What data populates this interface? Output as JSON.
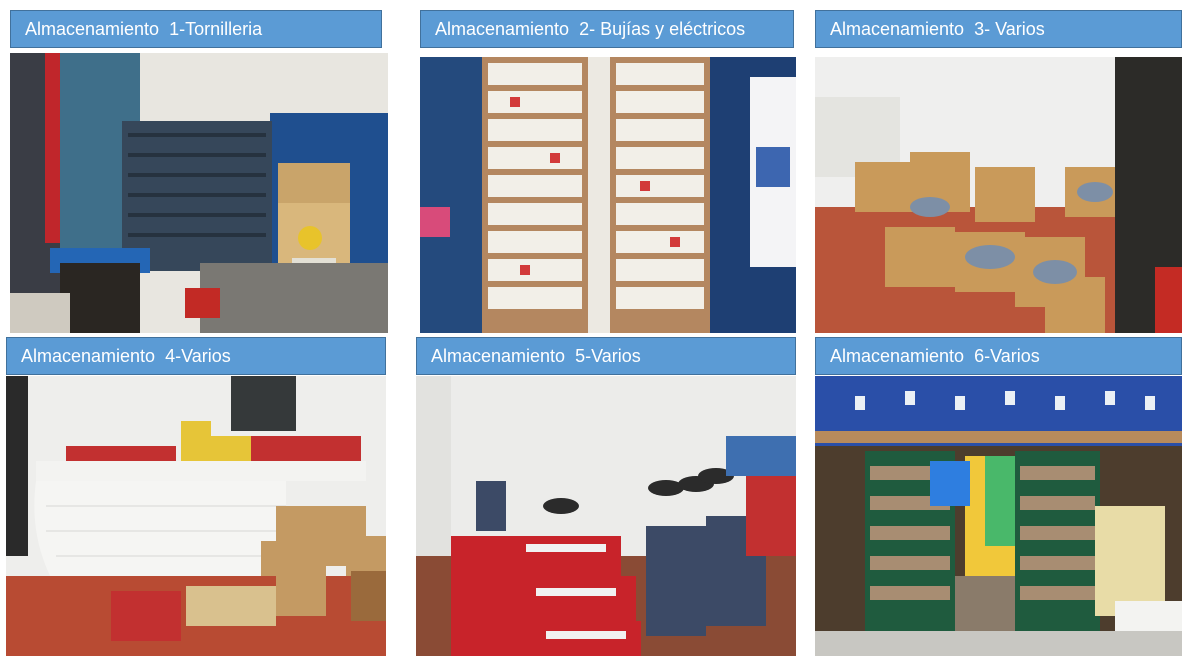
{
  "panels": [
    {
      "label": "Almacenamiento  1-Tornilleria"
    },
    {
      "label": "Almacenamiento  2- Bujías y eléctricos"
    },
    {
      "label": "Almacenamiento  3- Varios"
    },
    {
      "label": "Almacenamiento  4-Varios"
    },
    {
      "label": "Almacenamiento  5-Varios"
    },
    {
      "label": "Almacenamiento  6-Varios"
    }
  ],
  "photos": [
    {
      "subject": "screw-shelves-with-shell-helix-box"
    },
    {
      "subject": "spark-plug-box-wall-shelves"
    },
    {
      "subject": "open-boxes-on-floor"
    },
    {
      "subject": "boxes-on-tiled-counter"
    },
    {
      "subject": "shock-absorber-boxes-stacked"
    },
    {
      "subject": "warehouse-aisles-green-shelves"
    }
  ]
}
